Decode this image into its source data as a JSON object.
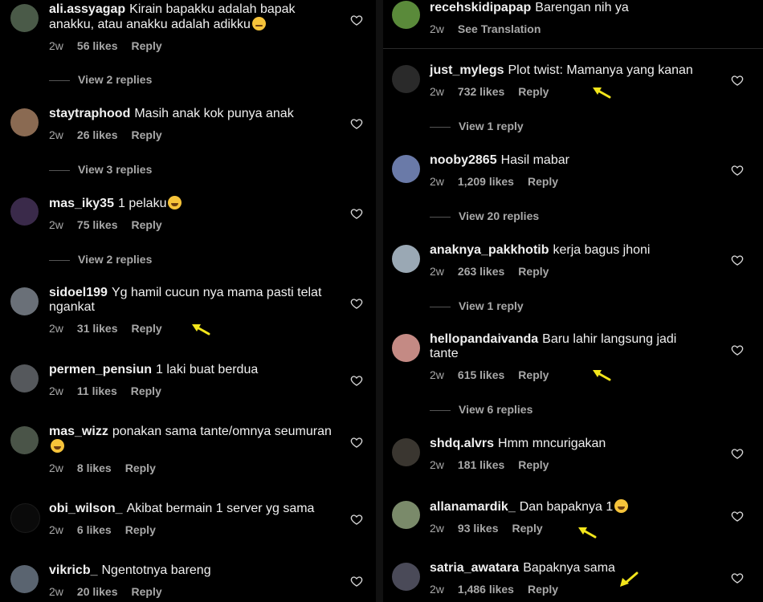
{
  "colors": {
    "background": "#000000",
    "text": "#f5f5f5",
    "muted": "#a8a8a8",
    "arrow": "#f2e51b"
  },
  "left": {
    "comments": [
      {
        "user": "ali.assyagap",
        "text": "Kirain bapakku adalah bapak anakku, atau anakku adalah adikku",
        "emoji": "crying-face",
        "time": "2w",
        "likes": "56 likes",
        "reply": "Reply",
        "view_replies": "View 2 replies",
        "avatar_color": "#4a5a48"
      },
      {
        "user": "staytraphood",
        "text": "Masih anak kok punya anak",
        "time": "2w",
        "likes": "26 likes",
        "reply": "Reply",
        "view_replies": "View 3 replies",
        "avatar_color": "#8a6a52"
      },
      {
        "user": "mas_iky35",
        "text": "1 pelaku",
        "emoji": "laughing-face",
        "time": "2w",
        "likes": "75 likes",
        "reply": "Reply",
        "view_replies": "View 2 replies",
        "avatar_color": "#3a2a4a"
      },
      {
        "user": "sidoel199",
        "text": "Yg hamil cucun nya mama pasti telat ngankat",
        "time": "2w",
        "likes": "31 likes",
        "reply": "Reply",
        "avatar_color": "#6a7078"
      },
      {
        "user": "permen_pensiun",
        "text": "1 laki buat berdua",
        "time": "2w",
        "likes": "11 likes",
        "reply": "Reply",
        "avatar_color": "#55585c"
      },
      {
        "user": "mas_wizz",
        "text": "ponakan sama tante/omnya seumuran",
        "emoji": "laughing-face",
        "time": "2w",
        "likes": "8 likes",
        "reply": "Reply",
        "avatar_color": "#4a5448"
      },
      {
        "user": "obi_wilson_",
        "text": "Akibat bermain 1 server yg sama",
        "time": "2w",
        "likes": "6 likes",
        "reply": "Reply",
        "avatar_color": "#0a0a0a"
      },
      {
        "user": "vikricb_",
        "text": "Ngentotnya bareng",
        "time": "2w",
        "likes": "20 likes",
        "reply": "Reply",
        "avatar_color": "#5a6470"
      }
    ]
  },
  "right": {
    "comments": [
      {
        "user": "recehskidipapap",
        "text": "Barengan nih ya",
        "time": "2w",
        "translate": "See Translation",
        "avatar_color": "#5a8a3a"
      },
      {
        "user": "just_mylegs",
        "text": "Plot twist: Mamanya yang kanan",
        "time": "2w",
        "likes": "732 likes",
        "reply": "Reply",
        "view_replies": "View 1 reply",
        "avatar_color": "#2a2a2a"
      },
      {
        "user": "nooby2865",
        "text": "Hasil mabar",
        "time": "2w",
        "likes": "1,209 likes",
        "reply": "Reply",
        "view_replies": "View 20 replies",
        "avatar_color": "#6a7aa8"
      },
      {
        "user": "anaknya_pakkhotib",
        "text": "kerja bagus jhoni",
        "time": "2w",
        "likes": "263 likes",
        "reply": "Reply",
        "view_replies": "View 1 reply",
        "avatar_color": "#9aa8b4"
      },
      {
        "user": "hellopandaivanda",
        "text": "Baru lahir langsung jadi tante",
        "time": "2w",
        "likes": "615 likes",
        "reply": "Reply",
        "view_replies": "View 6 replies",
        "avatar_color": "#c48a84"
      },
      {
        "user": "shdq.alvrs",
        "text": "Hmm mncurigakan",
        "time": "2w",
        "likes": "181 likes",
        "reply": "Reply",
        "avatar_color": "#3a3630"
      },
      {
        "user": "allanamardik_",
        "text": "Dan bapaknya 1",
        "emoji": "upside-down-face",
        "time": "2w",
        "likes": "93 likes",
        "reply": "Reply",
        "avatar_color": "#7a8a6a"
      },
      {
        "user": "satria_awatara",
        "text": "Bapaknya sama",
        "time": "2w",
        "likes": "1,486 likes",
        "reply": "Reply",
        "avatar_color": "#4a4a58"
      }
    ]
  }
}
